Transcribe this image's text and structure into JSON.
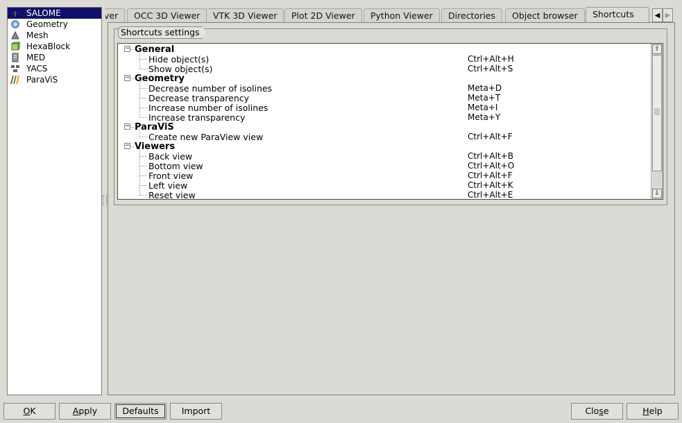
{
  "modules": [
    {
      "label": "SALOME",
      "icon": "salome-icon",
      "selected": true
    },
    {
      "label": "Geometry",
      "icon": "geometry-icon"
    },
    {
      "label": "Mesh",
      "icon": "mesh-icon"
    },
    {
      "label": "HexaBlock",
      "icon": "hexablock-icon"
    },
    {
      "label": "MED",
      "icon": "med-icon"
    },
    {
      "label": "YACS",
      "icon": "yacs-icon"
    },
    {
      "label": "ParaViS",
      "icon": "paravis-icon"
    }
  ],
  "tabs": {
    "partial": "ver",
    "occ": "OCC 3D Viewer",
    "vtk": "VTK 3D Viewer",
    "plot2d": "Plot 2D Viewer",
    "python": "Python Viewer",
    "directories": "Directories",
    "object_browser": "Object browser",
    "shortcuts": "Shortcuts"
  },
  "group_title": "Shortcuts settings",
  "tree": [
    {
      "category": "General",
      "items": [
        {
          "action": "Hide object(s)",
          "key": "Ctrl+Alt+H"
        },
        {
          "action": "Show object(s)",
          "key": "Ctrl+Alt+S"
        }
      ]
    },
    {
      "category": "Geometry",
      "items": [
        {
          "action": "Decrease number of isolines",
          "key": "Meta+D"
        },
        {
          "action": "Decrease transparency",
          "key": "Meta+T"
        },
        {
          "action": "Increase number of isolines",
          "key": "Meta+I"
        },
        {
          "action": "Increase transparency",
          "key": "Meta+Y"
        }
      ]
    },
    {
      "category": "ParaViS",
      "items": [
        {
          "action": "Create new ParaView view",
          "key": "Ctrl+Alt+F"
        }
      ]
    },
    {
      "category": "Viewers",
      "items": [
        {
          "action": "Back view",
          "key": "Ctrl+Alt+B"
        },
        {
          "action": "Bottom view",
          "key": "Ctrl+Alt+O"
        },
        {
          "action": "Front view",
          "key": "Ctrl+Alt+F"
        },
        {
          "action": "Left view",
          "key": "Ctrl+Alt+K"
        },
        {
          "action": "Reset view",
          "key": "Ctrl+Alt+E"
        }
      ]
    }
  ],
  "buttons": {
    "ok": {
      "mnemonic": "O",
      "rest": "K"
    },
    "apply": {
      "mnemonic": "A",
      "rest": "pply"
    },
    "defaults": "Defaults",
    "import": "Import",
    "close": {
      "pre": "Clo",
      "mnemonic": "s",
      "post": "e"
    },
    "help": {
      "mnemonic": "H",
      "rest": "elp"
    }
  },
  "colors": {
    "selection": "#10106b",
    "background": "#dcdad5"
  }
}
